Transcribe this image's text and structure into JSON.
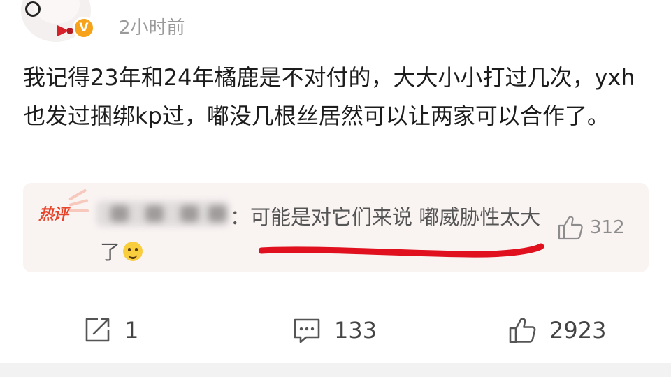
{
  "post": {
    "time": "2小时前",
    "text": "我记得23年和24年橘鹿是不对付的，大大小小打过几次，yxh也发过捆绑kp过，嘟没几根丝居然可以让两家可以合作了。",
    "verified_badge": "V"
  },
  "hot_comment": {
    "tag": "热评",
    "author_blurred": true,
    "text": "：可能是对它们来说 嘟威胁性太大了",
    "emoji": "smile-emoji",
    "like_count": "312"
  },
  "actions": {
    "repost_count": "1",
    "comment_count": "133",
    "like_count": "2923"
  },
  "colors": {
    "accent_orange": "#f6a31b",
    "hot_tag": "#e8442a",
    "hot_box_bg": "#f9f3f2",
    "annotation_red": "#e0101e"
  },
  "icons": {
    "repost": "edit-square-icon",
    "comment": "comment-bubble-icon",
    "like": "thumbs-up-icon"
  }
}
